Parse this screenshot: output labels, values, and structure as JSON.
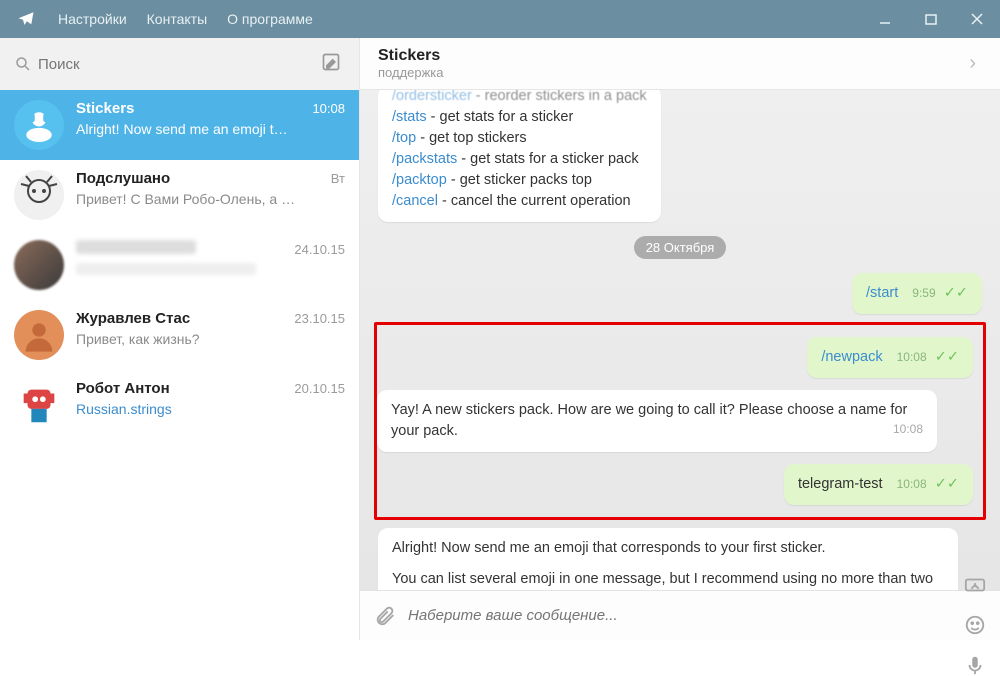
{
  "titlebar": {
    "menu": {
      "settings": "Настройки",
      "contacts": "Контакты",
      "about": "О программе"
    }
  },
  "search": {
    "placeholder": "Поиск"
  },
  "chats": [
    {
      "name": "Stickers",
      "time": "10:08",
      "last": "Alright! Now send me an emoji t…"
    },
    {
      "name": "Подслушано",
      "time": "Вт",
      "last": "Привет! С Вами Робо-Олень, а …"
    },
    {
      "name": "",
      "time": "24.10.15",
      "last": ""
    },
    {
      "name": "Журавлев Стас",
      "time": "23.10.15",
      "last": "Привет, как жизнь?"
    },
    {
      "name": "Робот Антон",
      "time": "20.10.15",
      "last": "Russian.strings"
    }
  ],
  "header": {
    "name": "Stickers",
    "status": "поддержка"
  },
  "commands": {
    "h0a": "/ordersticker",
    "h0b": " - reorder stickers in a pack",
    "c1a": "/stats",
    "c1b": " - get stats for a sticker",
    "c2a": "/top",
    "c2b": " - get top stickers",
    "c3a": "/packstats",
    "c3b": " - get stats for a sticker pack",
    "c4a": "/packtop",
    "c4b": " - get sticker packs top",
    "c5a": "/cancel",
    "c5b": " - cancel the current operation"
  },
  "date_badge": "28 Октября",
  "msgs": {
    "start": "/start",
    "start_time": "9:59",
    "newpack": "/newpack",
    "newpack_time": "10:08",
    "yay": "Yay! A new stickers pack. How are we going to call it? Please choose a name for your pack.",
    "yay_time": "10:08",
    "test": "telegram-test",
    "test_time": "10:08",
    "alright1": "Alright! Now send me an emoji that corresponds to your first sticker.",
    "alright2": "You can list several emoji in one message, but I recommend using no more than two per sticker."
  },
  "composer": {
    "placeholder": "Наберите ваше сообщение..."
  }
}
